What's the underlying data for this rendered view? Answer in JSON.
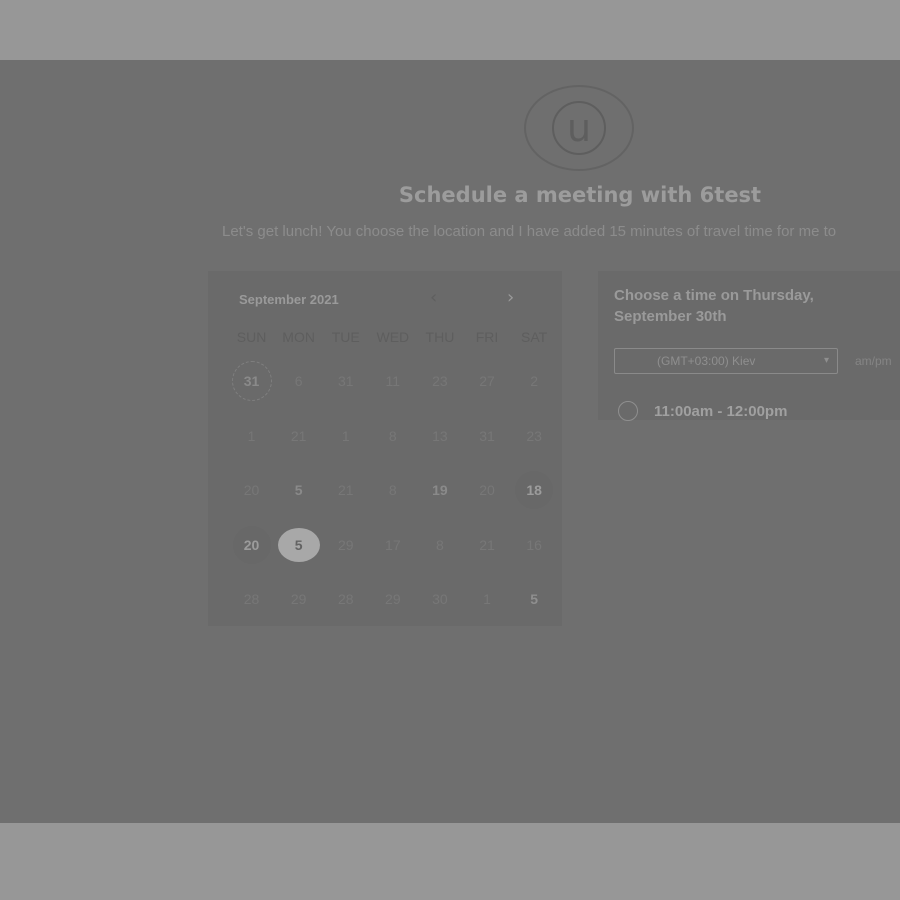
{
  "header": {
    "avatar_letter": "u",
    "title": "Schedule a meeting with 6test",
    "subtitle": "Let's get lunch! You choose the location and I have added 15 minutes of travel time for me to"
  },
  "calendar": {
    "month_label": "September 2021",
    "prev_icon": "‹",
    "next_icon": "›",
    "weekdays": [
      "SUN",
      "MON",
      "TUE",
      "WED",
      "THU",
      "FRI",
      "SAT"
    ],
    "weeks": [
      [
        "31",
        "6",
        "31",
        "11",
        "23",
        "27",
        "2"
      ],
      [
        "1",
        "21",
        "1",
        "8",
        "13",
        "31",
        "23"
      ],
      [
        "20",
        "5",
        "21",
        "8",
        "19",
        "20",
        "18"
      ],
      [
        "20",
        "5",
        "29",
        "17",
        "8",
        "21",
        "16"
      ],
      [
        "28",
        "29",
        "28",
        "29",
        "30",
        "1",
        "5"
      ]
    ]
  },
  "time_panel": {
    "heading": "Choose a time on Thursday, September 30th",
    "timezone": "(GMT+03:00) Kiev",
    "timezone_caret": "▾",
    "ampm_label": "am/pm",
    "slots": [
      "11:00am - 12:00pm"
    ]
  }
}
